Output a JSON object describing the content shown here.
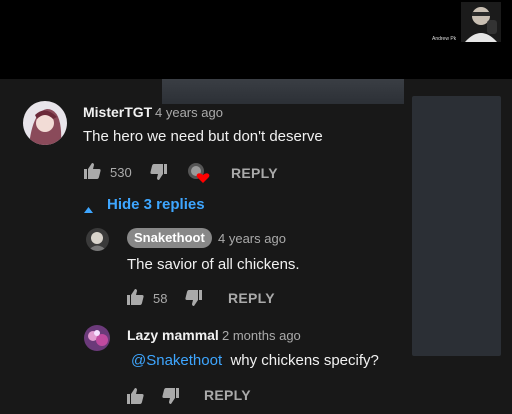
{
  "webcam": {
    "name": "Andrew Pk"
  },
  "comments": [
    {
      "author": "MisterTGT",
      "time": "4 years ago",
      "text": "The hero we need but don't deserve",
      "likes": "530",
      "reply_label": "REPLY"
    }
  ],
  "replies_toggle": {
    "arrow": "▲",
    "label": "Hide 3 replies"
  },
  "replies": [
    {
      "author": "Snakethoot",
      "time": "4 years ago",
      "text": "The savior of all chickens.",
      "likes": "58",
      "reply_label": "REPLY"
    },
    {
      "author": "Lazy mammal",
      "time": "2 months ago",
      "mention": "@Snakethoot",
      "text": "why chickens specify?",
      "reply_label": "REPLY"
    }
  ],
  "colors": {
    "link": "#3ea6ff",
    "heart": "#ff0000",
    "background": "#181818"
  },
  "icons": [
    "thumbs-up-icon",
    "thumbs-down-icon",
    "creator-heart-icon",
    "caret-up-icon"
  ]
}
